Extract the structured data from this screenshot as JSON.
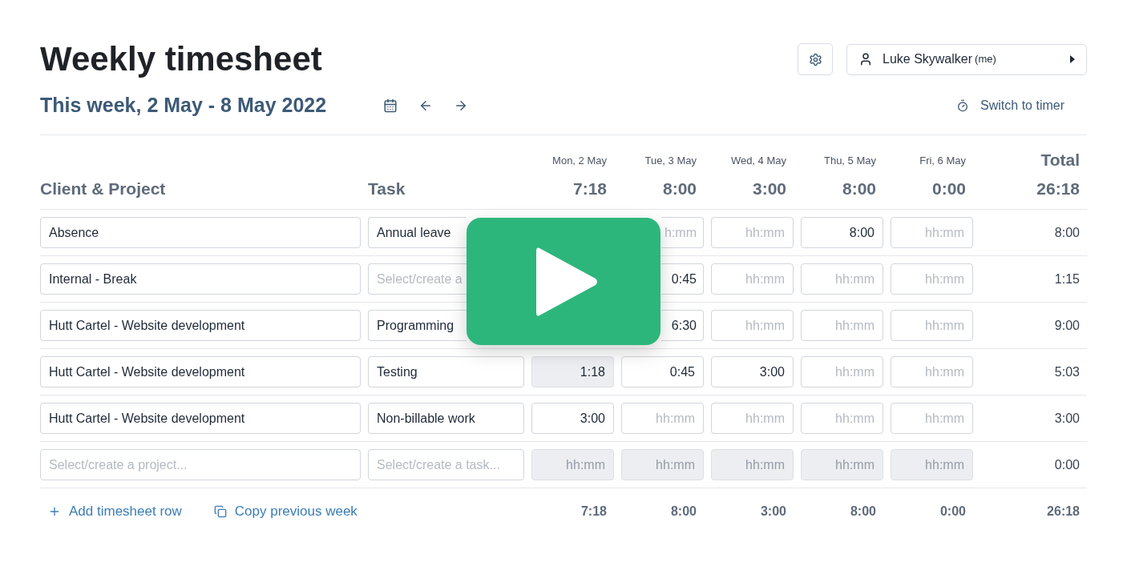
{
  "page": {
    "title": "Weekly timesheet",
    "period": "This week, 2 May - 8 May 2022"
  },
  "user": {
    "name": "Luke Skywalker",
    "note": "(me)"
  },
  "switch_link": "Switch to timer",
  "columns": {
    "project": "Client & Project",
    "task": "Task",
    "total_label": "Total",
    "grand_total": "26:18"
  },
  "days": [
    {
      "label": "Mon, 2 May",
      "total": "7:18"
    },
    {
      "label": "Tue, 3 May",
      "total": "8:00"
    },
    {
      "label": "Wed, 4 May",
      "total": "3:00"
    },
    {
      "label": "Thu, 5 May",
      "total": "8:00"
    },
    {
      "label": "Fri, 6 May",
      "total": "0:00"
    }
  ],
  "rows": [
    {
      "project": {
        "value": "Absence"
      },
      "task": {
        "value": "Annual leave"
      },
      "cells": [
        null,
        {
          "placeholder": "h:mm",
          "disabled": false
        },
        {
          "placeholder": "hh:mm",
          "disabled": false
        },
        {
          "value": "8:00",
          "disabled": false
        },
        {
          "placeholder": "hh:mm",
          "disabled": false
        }
      ],
      "total": "8:00"
    },
    {
      "project": {
        "value": "Internal - Break"
      },
      "task": {
        "placeholder": "Select/create a"
      },
      "cells": [
        null,
        {
          "value": "0:45",
          "disabled": false
        },
        {
          "placeholder": "hh:mm",
          "disabled": false
        },
        {
          "placeholder": "hh:mm",
          "disabled": false
        },
        {
          "placeholder": "hh:mm",
          "disabled": false
        }
      ],
      "total": "1:15"
    },
    {
      "project": {
        "value": "Hutt Cartel - Website development"
      },
      "task": {
        "value": "Programming"
      },
      "cells": [
        null,
        {
          "value": "6:30",
          "disabled": false
        },
        {
          "placeholder": "hh:mm",
          "disabled": false
        },
        {
          "placeholder": "hh:mm",
          "disabled": false
        },
        {
          "placeholder": "hh:mm",
          "disabled": false
        }
      ],
      "total": "9:00"
    },
    {
      "project": {
        "value": "Hutt Cartel - Website development"
      },
      "task": {
        "value": "Testing"
      },
      "cells": [
        {
          "value": "1:18",
          "disabled": true
        },
        {
          "value": "0:45",
          "disabled": false
        },
        {
          "value": "3:00",
          "disabled": false
        },
        {
          "placeholder": "hh:mm",
          "disabled": false
        },
        {
          "placeholder": "hh:mm",
          "disabled": false
        }
      ],
      "total": "5:03"
    },
    {
      "project": {
        "value": "Hutt Cartel - Website development"
      },
      "task": {
        "value": "Non-billable work"
      },
      "cells": [
        {
          "value": "3:00",
          "disabled": false
        },
        {
          "placeholder": "hh:mm",
          "disabled": false
        },
        {
          "placeholder": "hh:mm",
          "disabled": false
        },
        {
          "placeholder": "hh:mm",
          "disabled": false
        },
        {
          "placeholder": "hh:mm",
          "disabled": false
        }
      ],
      "total": "3:00"
    },
    {
      "project": {
        "placeholder": "Select/create a project..."
      },
      "task": {
        "placeholder": "Select/create a task..."
      },
      "cells": [
        {
          "placeholder": "hh:mm",
          "disabled": true
        },
        {
          "placeholder": "hh:mm",
          "disabled": true
        },
        {
          "placeholder": "hh:mm",
          "disabled": true
        },
        {
          "placeholder": "hh:mm",
          "disabled": true
        },
        {
          "placeholder": "hh:mm",
          "disabled": true
        }
      ],
      "total": "0:00"
    }
  ],
  "footer": {
    "add_row": "Add timesheet row",
    "copy_week": "Copy previous week",
    "totals": [
      "7:18",
      "8:00",
      "3:00",
      "8:00",
      "0:00",
      "26:18"
    ]
  }
}
